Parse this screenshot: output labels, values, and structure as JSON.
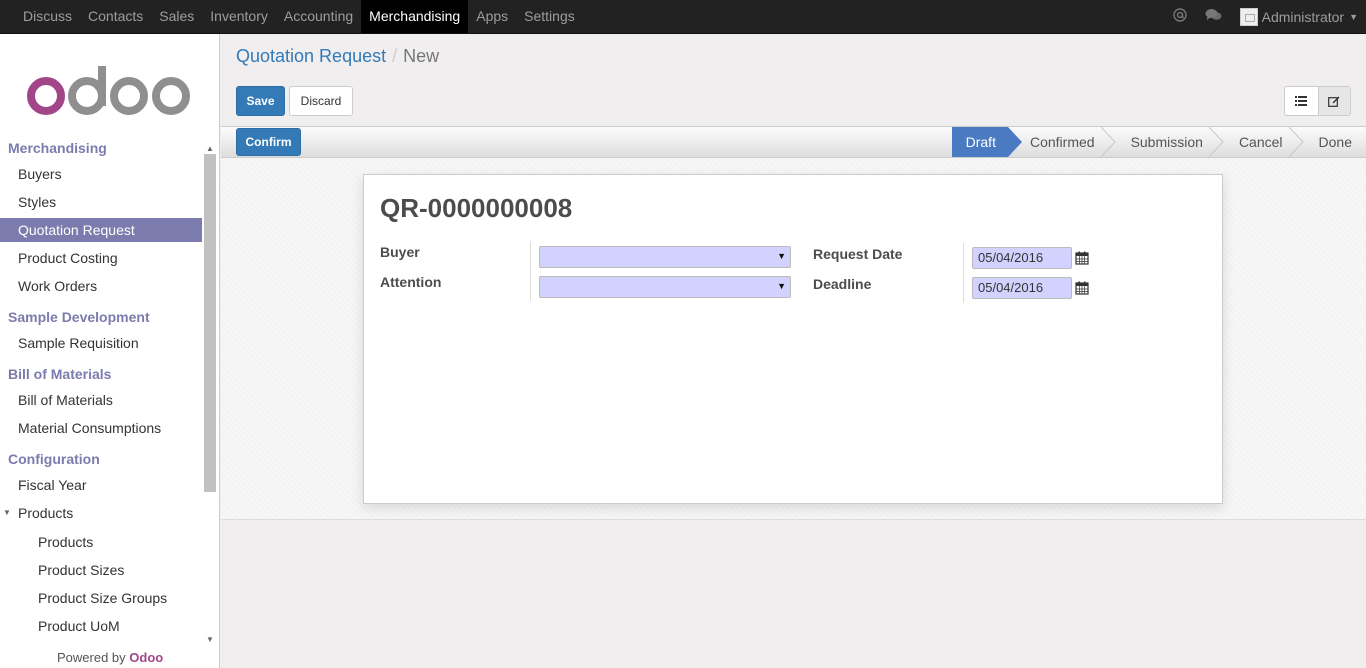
{
  "topnav": {
    "items": [
      {
        "label": "Discuss"
      },
      {
        "label": "Contacts"
      },
      {
        "label": "Sales"
      },
      {
        "label": "Inventory"
      },
      {
        "label": "Accounting"
      },
      {
        "label": "Merchandising",
        "active": true
      },
      {
        "label": "Apps"
      },
      {
        "label": "Settings"
      }
    ],
    "user": "Administrator",
    "icons": [
      "at-icon",
      "chat-icon"
    ]
  },
  "sidebar": {
    "sections": [
      {
        "title": "Merchandising",
        "items": [
          "Buyers",
          "Styles",
          "Quotation Request",
          "Product Costing",
          "Work Orders"
        ]
      },
      {
        "title": "Sample Development",
        "items": [
          "Sample Requisition"
        ]
      },
      {
        "title": "Bill of Materials",
        "items": [
          "Bill of Materials",
          "Material Consumptions"
        ]
      },
      {
        "title": "Configuration",
        "items": [
          "Fiscal Year",
          "Products"
        ],
        "subitems": [
          "Products",
          "Product Sizes",
          "Product Size Groups",
          "Product UoM"
        ]
      }
    ],
    "active": "Quotation Request",
    "footer": {
      "prefix": "Powered by",
      "brand": "Odoo"
    }
  },
  "breadcrumb": {
    "parent": "Quotation Request",
    "separator": "/",
    "current": "New"
  },
  "toolbar": {
    "save_label": "Save",
    "discard_label": "Discard"
  },
  "statusbar": {
    "confirm_label": "Confirm",
    "stages": [
      "Draft",
      "Confirmed",
      "Submission",
      "Cancel",
      "Done"
    ],
    "current_stage": "Draft"
  },
  "form": {
    "name": "QR-0000000008",
    "buyer_label": "Buyer",
    "buyer_value": "",
    "attention_label": "Attention",
    "attention_value": "",
    "request_date_label": "Request Date",
    "request_date_value": "05/04/2016",
    "deadline_label": "Deadline",
    "deadline_value": "05/04/2016"
  },
  "colors": {
    "brand": "#7c7bad",
    "primary": "#337ab7",
    "field_required": "#d2d2ff",
    "odoo_logo": "#a24689"
  }
}
